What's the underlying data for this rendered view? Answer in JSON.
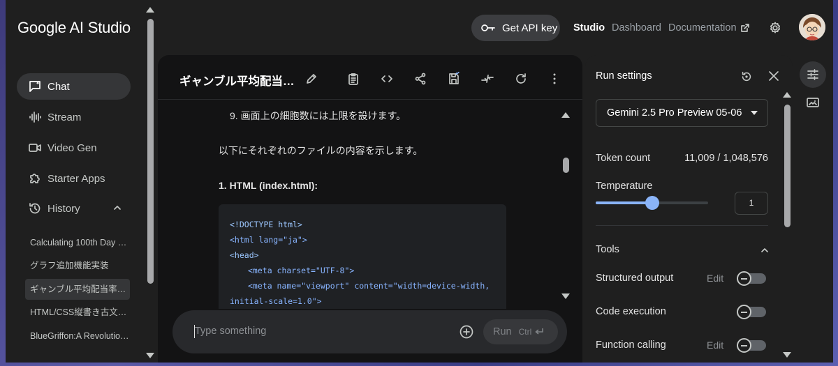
{
  "app": {
    "title": "Google AI Studio"
  },
  "sidebar": {
    "nav": [
      {
        "label": "Chat",
        "icon": "chat-icon",
        "active": true
      },
      {
        "label": "Stream",
        "icon": "waveform-icon"
      },
      {
        "label": "Video Gen",
        "icon": "video-icon"
      },
      {
        "label": "Starter Apps",
        "icon": "puzzle-icon"
      },
      {
        "label": "History",
        "icon": "history-icon"
      }
    ],
    "history": [
      "Calculating 100th Day …",
      "グラフ追加機能実装",
      "ギャンブル平均配当率…",
      "HTML/CSS縦書き古文…",
      "BlueGriffon:A Revolutio…"
    ]
  },
  "topbar": {
    "api_key_label": "Get API key",
    "studio": "Studio",
    "dashboard": "Dashboard",
    "documentation": "Documentation"
  },
  "chat": {
    "title": "ギャンブル平均配当…",
    "lines": {
      "item9": "9. 画面上の細胞数には上限を設けます。",
      "intro": "以下にそれぞれのファイルの内容を示します。",
      "heading": "1. HTML (index.html):"
    },
    "code": [
      "<!DOCTYPE html>",
      "<html lang=\"ja\">",
      "<head>",
      "<meta charset=\"UTF-8\">",
      "<meta name=\"viewport\" content=\"width=device-width,",
      "initial-scale=1.0\">"
    ],
    "input_placeholder": "Type something",
    "run_label": "Run",
    "run_shortcut": "Ctrl"
  },
  "settings": {
    "title": "Run settings",
    "model": "Gemini 2.5 Pro Preview 05-06",
    "token_count_label": "Token count",
    "token_count_value": "11,009 / 1,048,576",
    "temperature_label": "Temperature",
    "temperature_value": "1",
    "temperature_level": 0.5,
    "tools_label": "Tools",
    "tools": [
      {
        "label": "Structured output",
        "edit": "Edit",
        "enabled": false
      },
      {
        "label": "Code execution",
        "enabled": false
      },
      {
        "label": "Function calling",
        "edit": "Edit",
        "enabled": false
      }
    ]
  },
  "colors": {
    "accent": "#8ab4f8",
    "panel": "#1f1f1f",
    "chat_bg": "#131314"
  }
}
